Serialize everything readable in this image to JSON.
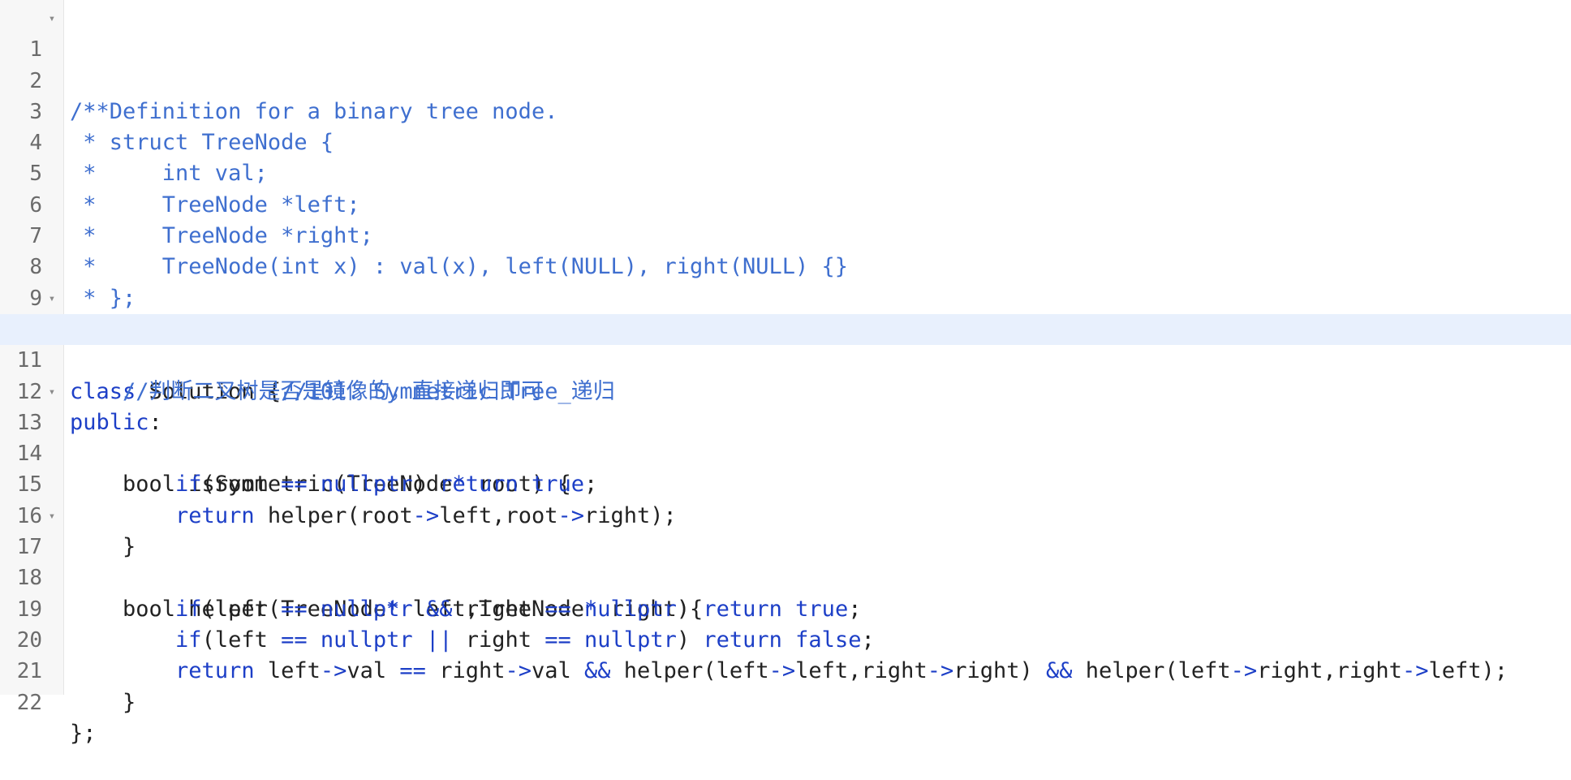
{
  "editor": {
    "active_line": 11,
    "line_numbers": [
      "1",
      "2",
      "3",
      "4",
      "5",
      "6",
      "7",
      "8",
      "9",
      "10",
      "11",
      "12",
      "13",
      "14",
      "15",
      "16",
      "17",
      "18",
      "19",
      "20",
      "21",
      "22"
    ],
    "fold_glyph": "▾",
    "colors": {
      "comment": "#3f6fcf",
      "keyword": "#1d3fc7",
      "plain": "#222222",
      "active_line": "#e8f0fd",
      "gutter": "#f7f7f7"
    },
    "lines": [
      "/**",
      " * Definition for a binary tree node.",
      " * struct TreeNode {",
      " *     int val;",
      " *     TreeNode *left;",
      " *     TreeNode *right;",
      " *     TreeNode(int x) : val(x), left(NULL), right(NULL) {}",
      " * };",
      " */",
      "class Solution {//101. Symmetric Tree_递归",
      "    //判断二叉树是否是镜像的，直接递归即可",
      "public:",
      "    bool isSymmetric(TreeNode* root) {",
      "        if(root == nullptr) return true;",
      "        return helper(root->left,root->right);",
      "    }",
      "    bool helper(TreeNode* left,TreeNode* right){",
      "        if(left == nullptr && right == nullptr) return true;",
      "        if(left == nullptr || right == nullptr) return false;",
      "        return left->val == right->val && helper(left->left,right->right) && helper(left->right,right->left);",
      "    }",
      "};"
    ],
    "fragments": {
      "l10": {
        "class": "class",
        "name": " Solution {",
        "comment": "//101. Symmetric Tree_递归"
      },
      "l11": {
        "indent": "    ",
        "comment": "//判断二叉树是否是镜像的，直接递归即可"
      },
      "l12": {
        "kw": "public",
        "rest": ":"
      },
      "l13": {
        "a": "    bool isSymmetric(TreeNode",
        "star": "*",
        "b": " root) {"
      },
      "l14": {
        "indent": "        ",
        "if": "if",
        "a": "(root ",
        "eq": "==",
        "sp": " ",
        "null": "nullptr",
        "b": ") ",
        "ret": "return",
        "sp2": " ",
        "true": "true",
        "end": ";"
      },
      "l15": {
        "indent": "        ",
        "ret": "return",
        "a": " helper(root",
        "arrow1": "->",
        "b": "left,root",
        "arrow2": "->",
        "c": "right);"
      },
      "l16": "    }",
      "l17": {
        "a": "    bool helper(TreeNode",
        "star1": "*",
        "b": " left,TreeNode",
        "star2": "*",
        "c": " right){"
      },
      "l18": {
        "indent": "        ",
        "if": "if",
        "a": "(left ",
        "eq1": "==",
        "sp1": " ",
        "null1": "nullptr",
        "sp2": " ",
        "and": "&&",
        "b": " right ",
        "eq2": "==",
        "sp3": " ",
        "null2": "nullptr",
        "c": ") ",
        "ret": "return",
        "sp4": " ",
        "true": "true",
        "end": ";"
      },
      "l19": {
        "indent": "        ",
        "if": "if",
        "a": "(left ",
        "eq1": "==",
        "sp1": " ",
        "null1": "nullptr",
        "sp2": " ",
        "or": "||",
        "b": " right ",
        "eq2": "==",
        "sp3": " ",
        "null2": "nullptr",
        "c": ") ",
        "ret": "return",
        "sp4": " ",
        "false": "false",
        "end": ";"
      },
      "l20": {
        "indent": "        ",
        "ret": "return",
        "a": " left",
        "ar1": "->",
        "b": "val ",
        "eq": "==",
        "c": " right",
        "ar2": "->",
        "d": "val ",
        "and1": "&&",
        "e": " helper(left",
        "ar3": "->",
        "f": "left,right",
        "ar4": "->",
        "g": "right) ",
        "and2": "&&",
        "h": " helper(left",
        "ar5": "->",
        "i": "right,right",
        "ar6": "->",
        "j": "left);"
      },
      "l21": "    }",
      "l22": "};"
    }
  }
}
